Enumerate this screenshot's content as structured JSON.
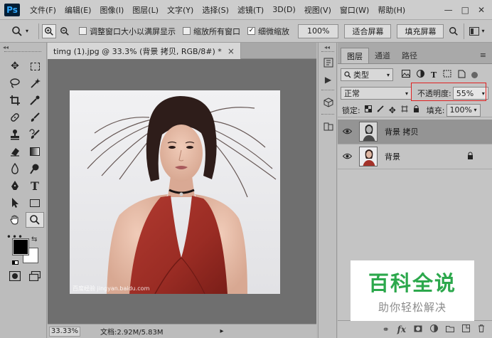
{
  "app": {
    "logo": "Ps"
  },
  "menu": [
    "文件(F)",
    "编辑(E)",
    "图像(I)",
    "图层(L)",
    "文字(Y)",
    "选择(S)",
    "滤镜(T)",
    "3D(D)",
    "视图(V)",
    "窗口(W)",
    "帮助(H)"
  ],
  "window_buttons": {
    "minimize": "—",
    "maximize": "□",
    "close": "✕"
  },
  "options": {
    "resize_windows_label": "调整窗口大小以满屏显示",
    "zoom_all_label": "缩放所有窗口",
    "scrubby_zoom_label": "细微缩放",
    "zoom_value": "100%",
    "fit_screen": "适合屏幕",
    "fill_screen": "填充屏幕"
  },
  "document": {
    "tab_title": "timg (1).jpg @ 33.3% (背景 拷贝, RGB/8#) *",
    "tab_close": "×",
    "watermark_text": "百度经验 jingyan.baidu.com"
  },
  "status": {
    "zoom": "33.33%",
    "doc_info": "文档:2.92M/5.83M"
  },
  "layers_panel": {
    "tabs": [
      "图层",
      "通道",
      "路径"
    ],
    "filter_label": "类型",
    "blend_mode": "正常",
    "opacity_label": "不透明度:",
    "opacity_value": "55%",
    "lock_label": "锁定:",
    "fill_label": "填充:",
    "fill_value": "100%",
    "layers": [
      {
        "name": "背景 拷贝",
        "selected": true,
        "locked": false
      },
      {
        "name": "背景",
        "selected": false,
        "locked": true
      }
    ]
  },
  "overlay": {
    "title": "百科全说",
    "subtitle": "助你轻松解决"
  },
  "colors": {
    "accent_red": "#e02020",
    "overlay_green": "#2ca84c"
  }
}
